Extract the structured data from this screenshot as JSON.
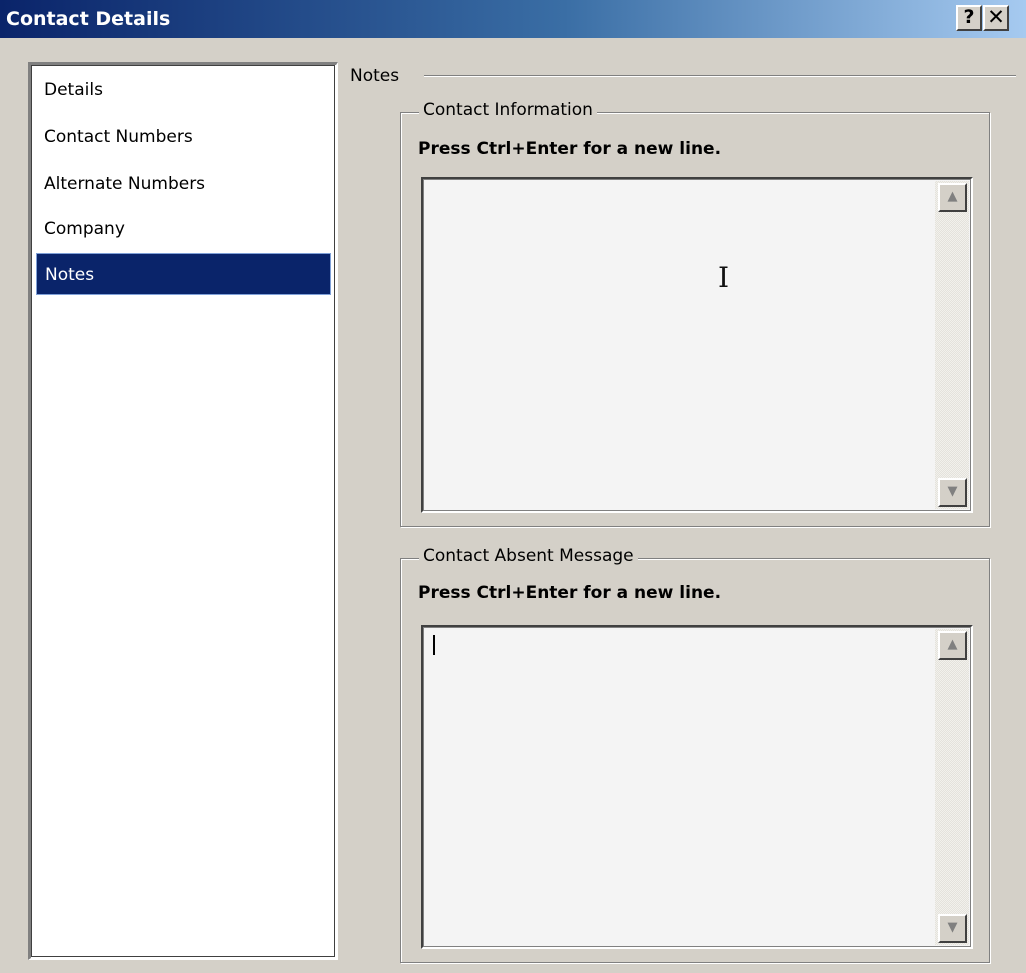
{
  "window": {
    "title": "Contact Details",
    "help_label": "?",
    "close_label": "✕"
  },
  "sidebar": {
    "items": [
      {
        "label": "Details",
        "selected": false
      },
      {
        "label": "Contact Numbers",
        "selected": false
      },
      {
        "label": "Alternate Numbers",
        "selected": false
      },
      {
        "label": "Company",
        "selected": false
      },
      {
        "label": "Notes",
        "selected": true
      }
    ]
  },
  "section": {
    "title": "Notes"
  },
  "contact_information": {
    "legend": "Contact Information",
    "hint": "Press Ctrl+Enter for a new line.",
    "value": ""
  },
  "contact_absent_message": {
    "legend": "Contact Absent Message",
    "hint": "Press Ctrl+Enter for a new line.",
    "value": ""
  },
  "icons": {
    "scroll_up": "▲",
    "scroll_down": "▼",
    "text_cursor": "I"
  },
  "colors": {
    "selection": "#0a246a",
    "titlebar_start": "#0a246a",
    "titlebar_end": "#a6caf0",
    "dialog_bg": "#d4d0c8"
  }
}
